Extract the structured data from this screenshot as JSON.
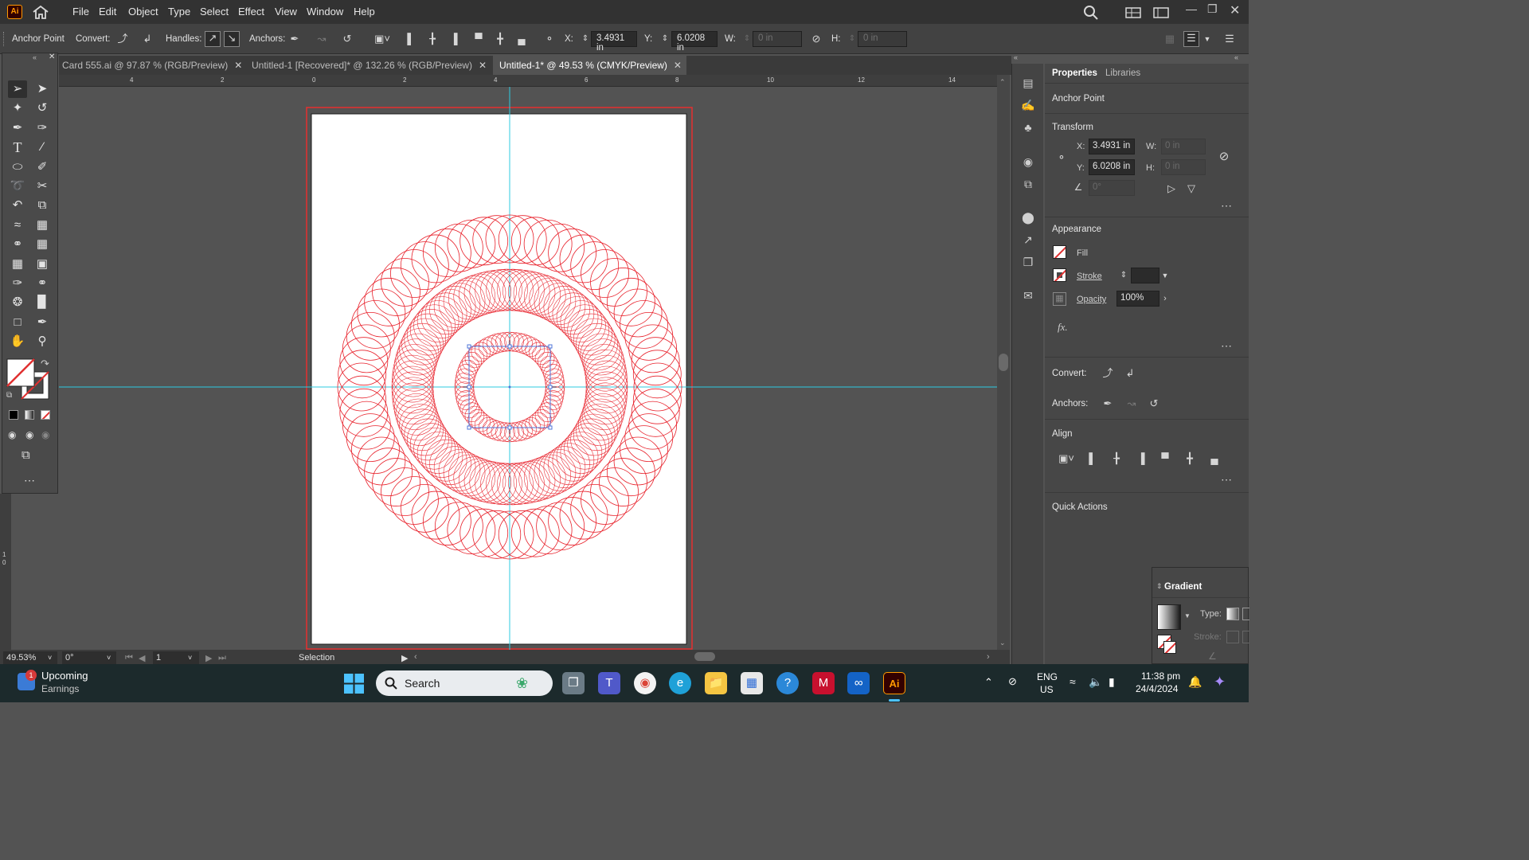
{
  "app": {
    "logo": "Ai",
    "menu": [
      "File",
      "Edit",
      "Object",
      "Type",
      "Select",
      "Effect",
      "View",
      "Window",
      "Help"
    ]
  },
  "control_bar": {
    "mode_label": "Anchor Point",
    "convert_label": "Convert:",
    "handles_label": "Handles:",
    "anchors_label": "Anchors:",
    "x_label": "X:",
    "x_value": "3.4931 in",
    "y_label": "Y:",
    "y_value": "6.0208 in",
    "w_label": "W:",
    "w_value": "0 in",
    "h_label": "H:",
    "h_value": "0 in"
  },
  "tabs": [
    {
      "label": "Card 555.ai @ 97.87 % (RGB/Preview)",
      "active": false
    },
    {
      "label": "Untitled-1 [Recovered]* @ 132.26 % (RGB/Preview)",
      "active": false
    },
    {
      "label": "Untitled-1* @ 49.53 % (CMYK/Preview)",
      "active": true
    }
  ],
  "ruler": {
    "h_ticks": [
      "4",
      "2",
      "0",
      "2",
      "4",
      "6",
      "8",
      "10",
      "12",
      "14"
    ],
    "v_ticks": [
      "1",
      "0"
    ]
  },
  "status_bar": {
    "zoom": "49.53%",
    "rotation": "0°",
    "artboard": "1",
    "tool": "Selection"
  },
  "properties": {
    "tab_properties": "Properties",
    "tab_libraries": "Libraries",
    "context": "Anchor Point",
    "transform": {
      "title": "Transform",
      "x_label": "X:",
      "x_value": "3.4931 in",
      "y_label": "Y:",
      "y_value": "6.0208 in",
      "w_label": "W:",
      "w_value": "0 in",
      "h_label": "H:",
      "h_value": "0 in",
      "angle_value": "0°"
    },
    "appearance": {
      "title": "Appearance",
      "fill_label": "Fill",
      "stroke_label": "Stroke",
      "opacity_label": "Opacity",
      "opacity_value": "100%",
      "fx_label": "fx."
    },
    "convert_label": "Convert:",
    "anchors_label": "Anchors:",
    "align_title": "Align",
    "quick_actions_title": "Quick Actions"
  },
  "gradient_panel": {
    "title": "Gradient",
    "type_label": "Type:",
    "stroke_label": "Stroke:"
  },
  "taskbar": {
    "widget_title": "Upcoming",
    "widget_subtitle": "Earnings",
    "widget_badge": "1",
    "search_placeholder": "Search",
    "lang_top": "ENG",
    "lang_bottom": "US",
    "time": "11:38 pm",
    "date": "24/4/2024"
  },
  "colors": {
    "artwork_stroke": "#e8202a",
    "guide": "#2ecbe0",
    "selection": "#4f74d9",
    "bleed": "#e63030"
  }
}
